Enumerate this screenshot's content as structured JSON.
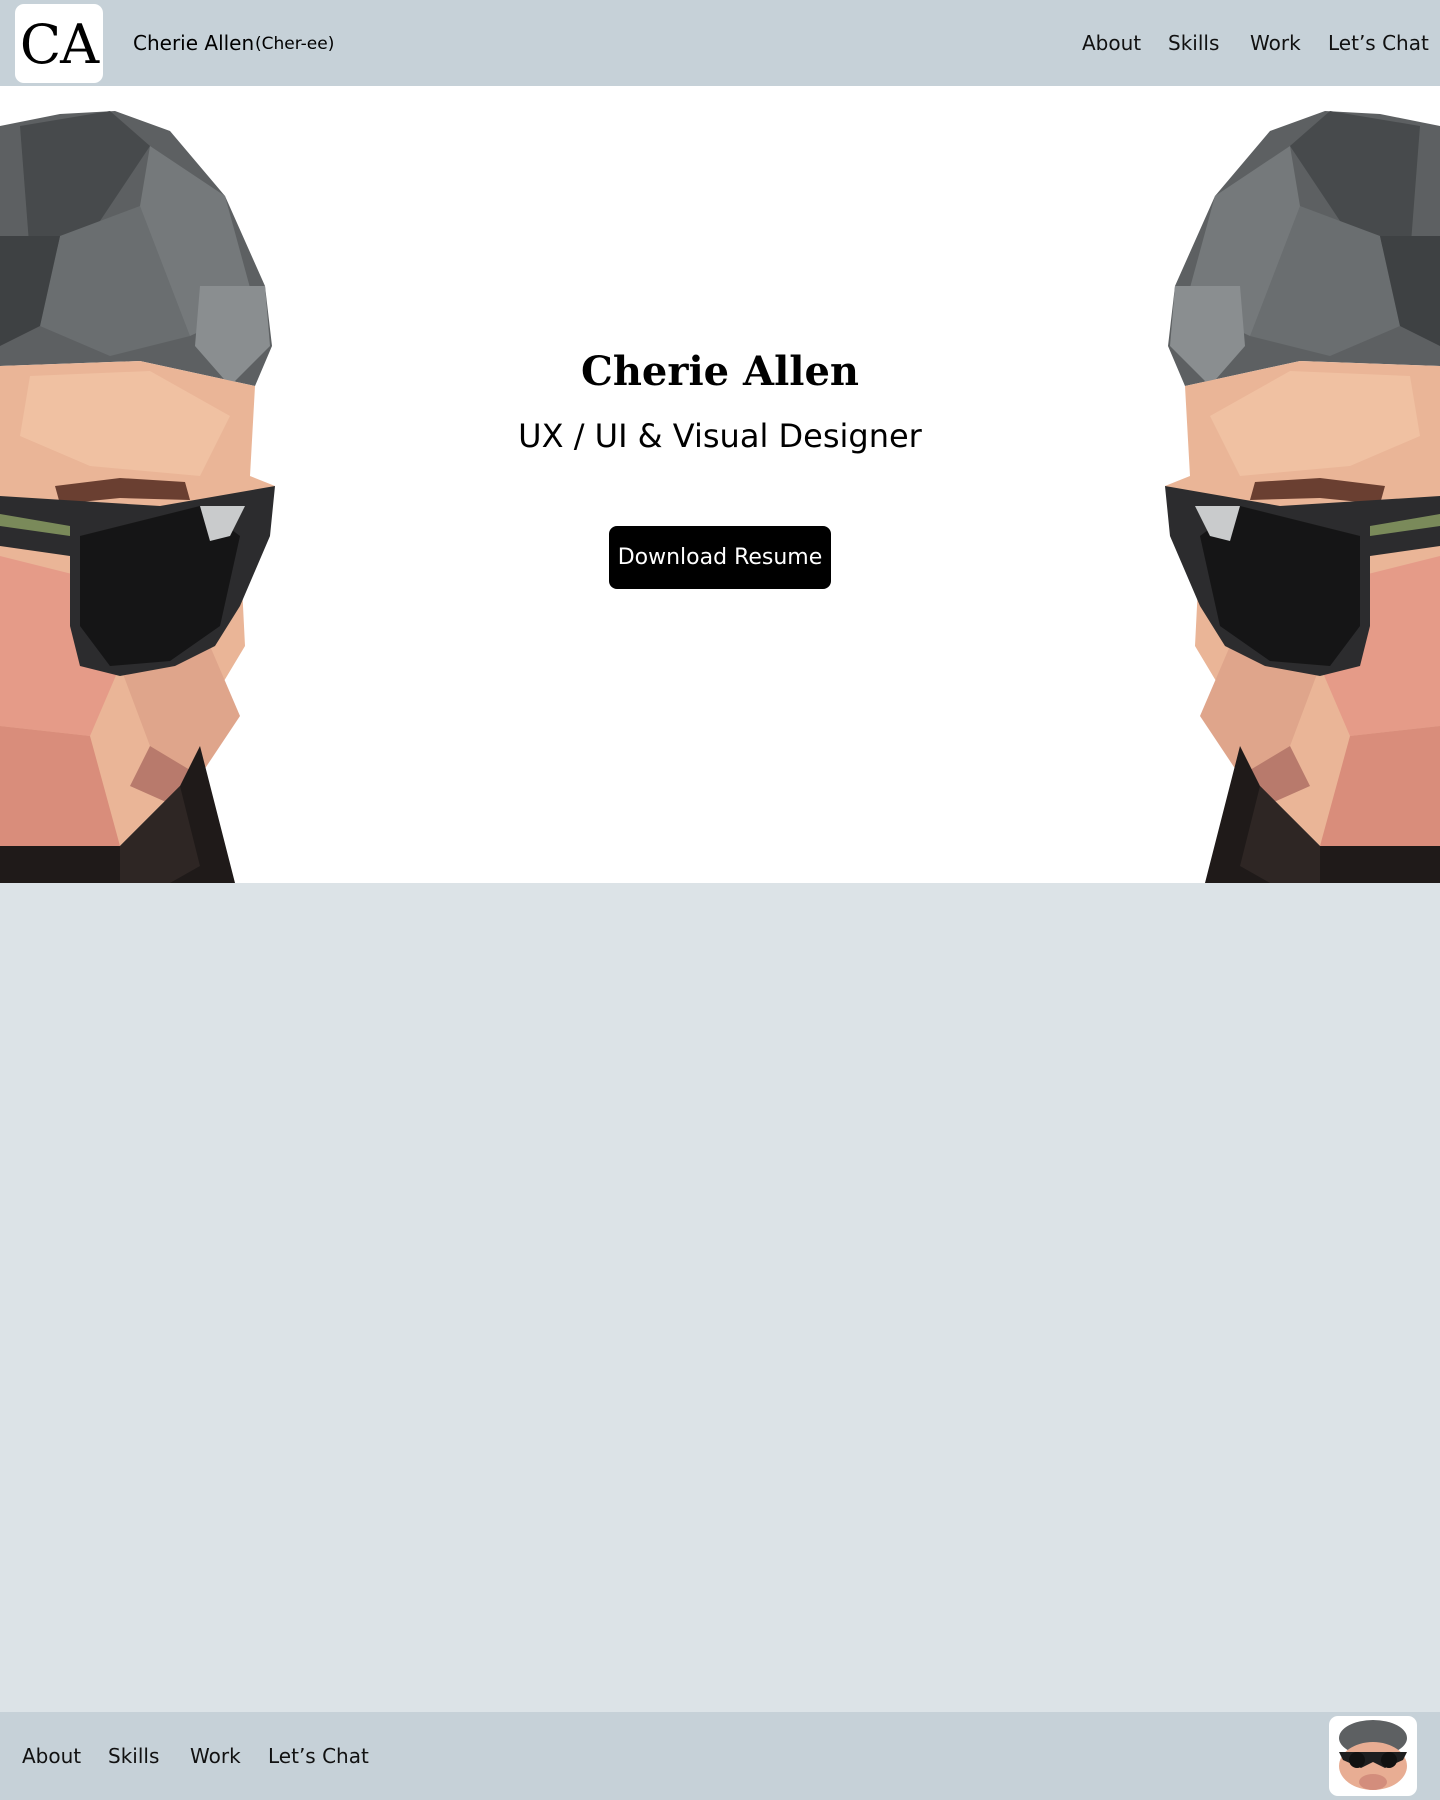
{
  "header": {
    "logo_text": "CA",
    "brand_name": "Cherie Allen",
    "brand_pronunciation": "(Cher-ee)",
    "nav": [
      {
        "label": "About"
      },
      {
        "label": "Skills"
      },
      {
        "label": "Work"
      },
      {
        "label": "Let’s Chat"
      }
    ]
  },
  "hero": {
    "title": "Cherie Allen",
    "subtitle": "UX / UI & Visual Designer",
    "button_label": "Download Resume",
    "portrait_icon": "low-poly-portrait-with-sunglasses"
  },
  "footer": {
    "nav": [
      {
        "label": "About"
      },
      {
        "label": "Skills"
      },
      {
        "label": "Work"
      },
      {
        "label": "Let’s Chat"
      }
    ],
    "avatar_icon": "mirrored-portrait-avatar"
  },
  "colors": {
    "header_bg": "#c6d1d8",
    "page_bg": "#dce3e7",
    "hero_bg": "#ffffff",
    "button_bg": "#000000",
    "button_text": "#ffffff"
  }
}
